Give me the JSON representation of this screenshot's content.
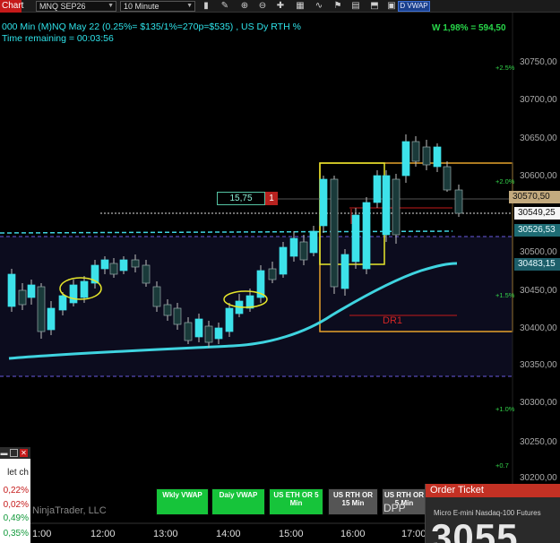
{
  "toolbar": {
    "chart_tab": "Chart",
    "instrument": "MNQ SEP26",
    "interval": "10 Minute",
    "dvwap_button": "D VWAP"
  },
  "header": {
    "line1": "000 Min (M)NQ May 22 (0.25%= $135/1%=270p=$535) , US Dy RTH %",
    "line2": "Time remaining = 00:03:56",
    "w_label": "W 1,98% = 594,50"
  },
  "colors": {
    "up_candle": "#3de2ea",
    "down_candle": "#1a3a3a",
    "vwap_line": "#3fd4e0",
    "accent_red": "#c51a1a",
    "green": "#16c43a"
  },
  "price_axis": {
    "labels": [
      "30750,00",
      "30700,00",
      "30650,00",
      "30600,00",
      "30500,00",
      "30450,00",
      "30400,00",
      "30350,00",
      "30300,00",
      "30250,00",
      "30200,00"
    ],
    "pct_labels": [
      "+2.5%",
      "+2.0%",
      "+1.5%",
      "+1.0%",
      "+0.7"
    ],
    "badges": {
      "b1": "30570,50",
      "b2": "30549,25",
      "b3": "30526,53",
      "b4": "30483,15"
    }
  },
  "time_axis": [
    "1:00",
    "12:00",
    "13:00",
    "14:00",
    "15:00",
    "16:00",
    "17:00"
  ],
  "trade": {
    "qty": "15,75",
    "count": "1"
  },
  "annotations": {
    "dr1": "DR1"
  },
  "buttons": [
    {
      "label": "Wkly VWAP"
    },
    {
      "label": "Daiy VWAP"
    },
    {
      "label": "US ETH OR 5 Min"
    },
    {
      "label": "US RTH OR 15 Min"
    },
    {
      "label": "US RTH OR 5 Min"
    }
  ],
  "mini_panel": {
    "title": "let ch",
    "rows": [
      "0,22%",
      "0,02%",
      "0,49%",
      "0,35%"
    ]
  },
  "footer": {
    "ninja": "NinjaTrader, LLC",
    "dpp": "DPP"
  },
  "order_ticket": {
    "title": "Order Ticket",
    "subtitle": "Micro E-mini Nasdaq-100 Futures",
    "price": "3055"
  }
}
